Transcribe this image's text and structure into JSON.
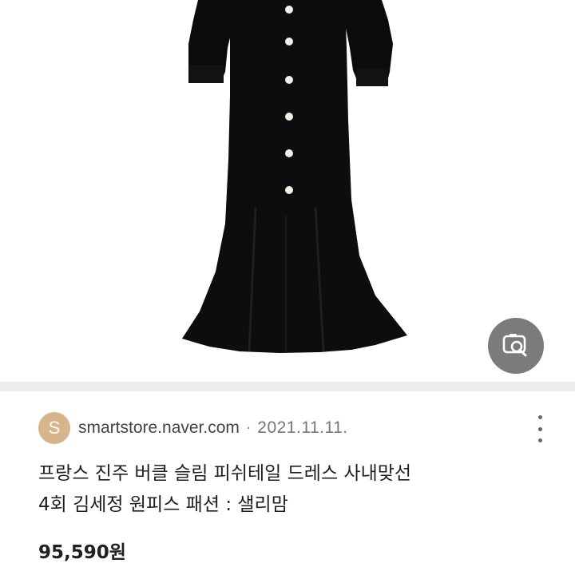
{
  "result": {
    "source": {
      "favicon_letter": "S",
      "domain": "smartstore.naver.com",
      "separator": "·",
      "date": "2021.11.11."
    },
    "title_line1": "프랑스 진주 버클 슬림 피쉬테일 드레스 사내맞선",
    "title_line2": "4회 김세정 원피스 패션 : 샐리맘",
    "price": "95,590원"
  },
  "icons": {
    "lens": "image-search-icon",
    "more": "more-vertical-icon"
  },
  "colors": {
    "favicon_bg": "#d8b48a",
    "lens_bg": "#7b7b7b"
  }
}
